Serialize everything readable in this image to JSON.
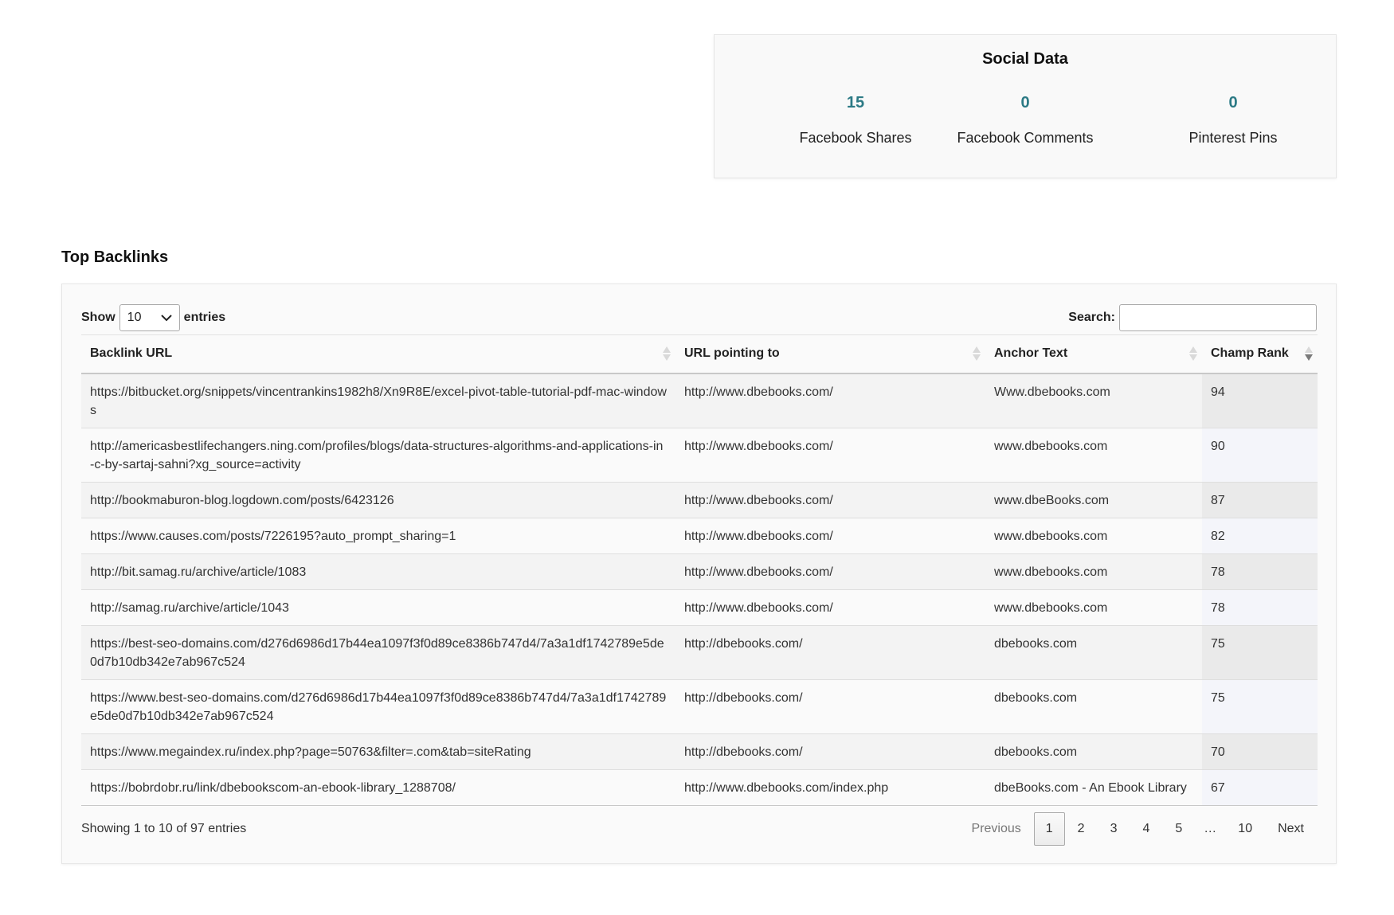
{
  "social": {
    "title": "Social Data",
    "stats": [
      {
        "value": "15",
        "label": "Facebook Shares"
      },
      {
        "value": "0",
        "label": "Facebook Comments"
      },
      {
        "value": "0",
        "label": "Pinterest Pins"
      }
    ]
  },
  "backlinks": {
    "title": "Top Backlinks",
    "length": {
      "prefix": "Show",
      "value": "10",
      "suffix": "entries"
    },
    "search": {
      "label": "Search:",
      "value": ""
    },
    "columns": [
      "Backlink URL",
      "URL pointing to",
      "Anchor Text",
      "Champ Rank"
    ],
    "rows": [
      [
        "https://bitbucket.org/snippets/vincentrankins1982h8/Xn9R8E/excel-pivot-table-tutorial-pdf-mac-windows",
        "http://www.dbebooks.com/",
        "Www.dbebooks.com",
        "94"
      ],
      [
        "http://americasbestlifechangers.ning.com/profiles/blogs/data-structures-algorithms-and-applications-in-c-by-sartaj-sahni?xg_source=activity",
        "http://www.dbebooks.com/",
        "www.dbebooks.com",
        "90"
      ],
      [
        "http://bookmaburon-blog.logdown.com/posts/6423126",
        "http://www.dbebooks.com/",
        "www.dbeBooks.com",
        "87"
      ],
      [
        "https://www.causes.com/posts/7226195?auto_prompt_sharing=1",
        "http://www.dbebooks.com/",
        "www.dbebooks.com",
        "82"
      ],
      [
        "http://bit.samag.ru/archive/article/1083",
        "http://www.dbebooks.com/",
        "www.dbebooks.com",
        "78"
      ],
      [
        "http://samag.ru/archive/article/1043",
        "http://www.dbebooks.com/",
        "www.dbebooks.com",
        "78"
      ],
      [
        "https://best-seo-domains.com/d276d6986d17b44ea1097f3f0d89ce8386b747d4/7a3a1df1742789e5de0d7b10db342e7ab967c524",
        "http://dbebooks.com/",
        "dbebooks.com",
        "75"
      ],
      [
        "https://www.best-seo-domains.com/d276d6986d17b44ea1097f3f0d89ce8386b747d4/7a3a1df1742789e5de0d7b10db342e7ab967c524",
        "http://dbebooks.com/",
        "dbebooks.com",
        "75"
      ],
      [
        "https://www.megaindex.ru/index.php?page=50763&filter=.com&tab=siteRating",
        "http://dbebooks.com/",
        "dbebooks.com",
        "70"
      ],
      [
        "https://bobrdobr.ru/link/dbebookscom-an-ebook-library_1288708/",
        "http://www.dbebooks.com/index.php",
        "dbeBooks.com - An Ebook Library",
        "67"
      ]
    ],
    "info": "Showing 1 to 10 of 97 entries",
    "pagination": {
      "previous": "Previous",
      "pages": [
        "1",
        "2",
        "3",
        "4",
        "5"
      ],
      "ellipsis": "…",
      "last": "10",
      "next": "Next",
      "current": "1"
    }
  }
}
